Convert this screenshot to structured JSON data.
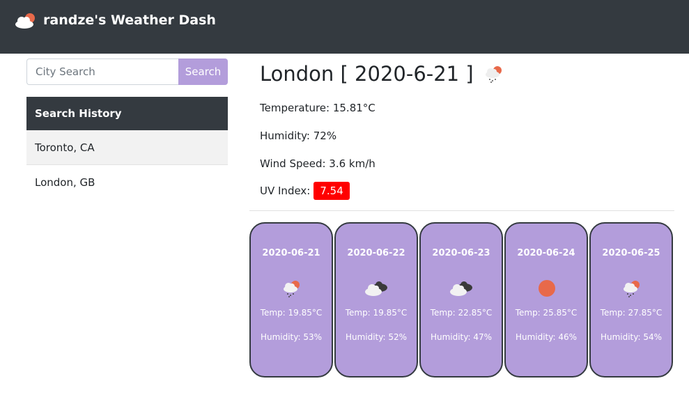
{
  "header": {
    "title": "randze's Weather Dash",
    "icon": "cloud-sun-icon"
  },
  "search": {
    "placeholder": "City Search",
    "button_label": "Search"
  },
  "history": {
    "title": "Search History",
    "items": [
      {
        "label": "Toronto, CA"
      },
      {
        "label": "London, GB"
      }
    ]
  },
  "current": {
    "city_title": "London [ 2020-6-21 ]",
    "icon": "rain-sun-icon",
    "temperature": "Temperature: 15.81°C",
    "humidity": "Humidity: 72%",
    "wind": "Wind Speed: 3.6 km/h",
    "uv_label": "UV Index:",
    "uv_value": "7.54",
    "uv_color": "#ff0000"
  },
  "forecast": [
    {
      "date": "2020-06-21",
      "icon": "rain-sun-icon",
      "temp": "Temp: 19.85°C",
      "humidity": "Humidity: 53%"
    },
    {
      "date": "2020-06-22",
      "icon": "clouds-icon",
      "temp": "Temp: 19.85°C",
      "humidity": "Humidity: 52%"
    },
    {
      "date": "2020-06-23",
      "icon": "clouds-icon",
      "temp": "Temp: 22.85°C",
      "humidity": "Humidity: 47%"
    },
    {
      "date": "2020-06-24",
      "icon": "sun-icon",
      "temp": "Temp: 25.85°C",
      "humidity": "Humidity: 46%"
    },
    {
      "date": "2020-06-25",
      "icon": "rain-sun-icon",
      "temp": "Temp: 27.85°C",
      "humidity": "Humidity: 54%"
    }
  ],
  "colors": {
    "navbar": "#343a40",
    "accent": "#b39ddb",
    "sun": "#e8694a"
  }
}
